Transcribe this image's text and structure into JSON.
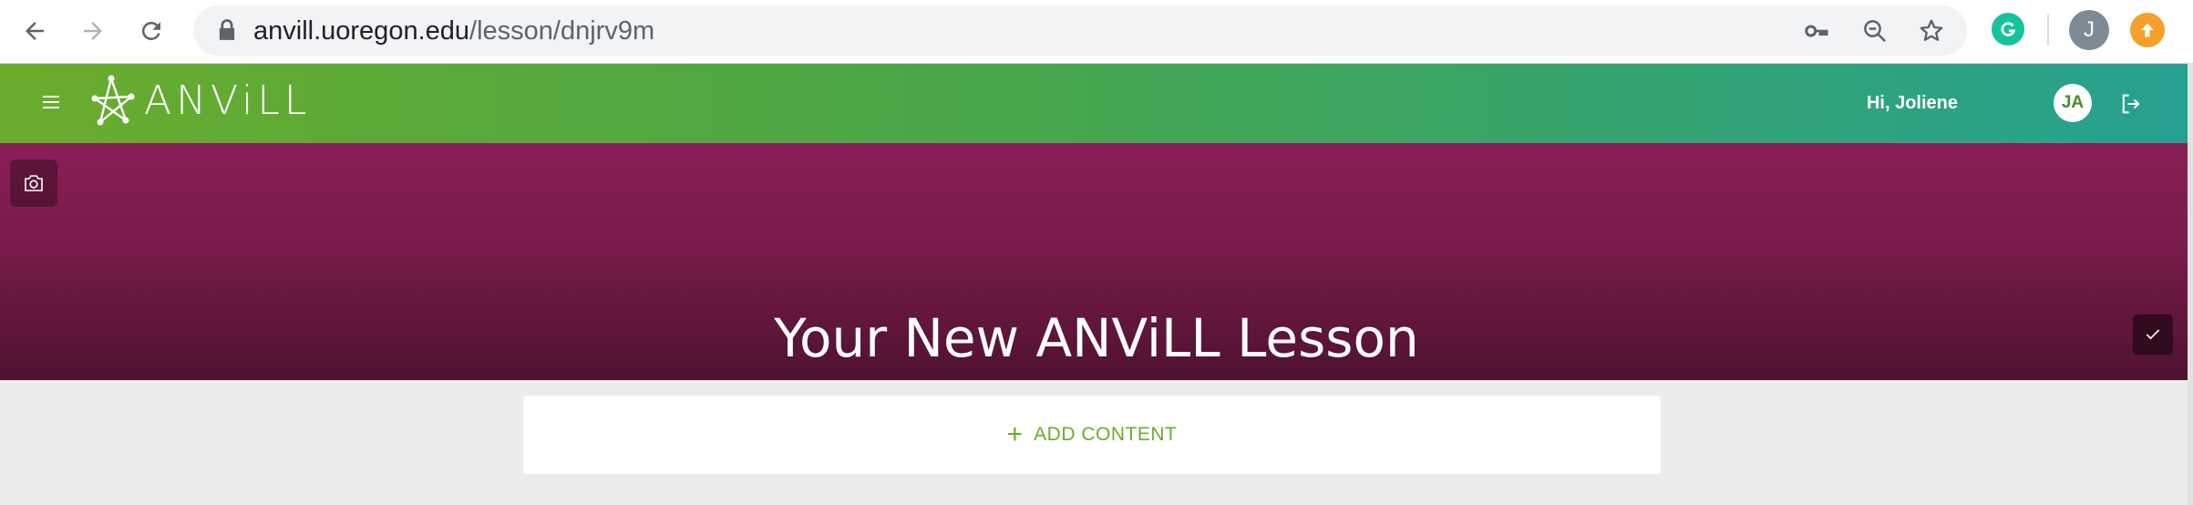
{
  "browser": {
    "url_host": "anvill.uoregon.edu",
    "url_path": "/lesson/dnjrv9m",
    "profile_initial": "J",
    "extensions": [
      "grammarly-icon"
    ]
  },
  "header": {
    "logo_text": "ANViLL",
    "greeting": "Hi, Joliene",
    "avatar_initials": "JA"
  },
  "hero": {
    "title": "Your New ANViLL Lesson"
  },
  "content": {
    "add_label": "ADD CONTENT"
  },
  "colors": {
    "header_start": "#6aac2d",
    "header_end": "#25a191",
    "hero_top": "#8a1f57",
    "hero_bottom": "#4f1230",
    "accent_green": "#6aac2d"
  }
}
